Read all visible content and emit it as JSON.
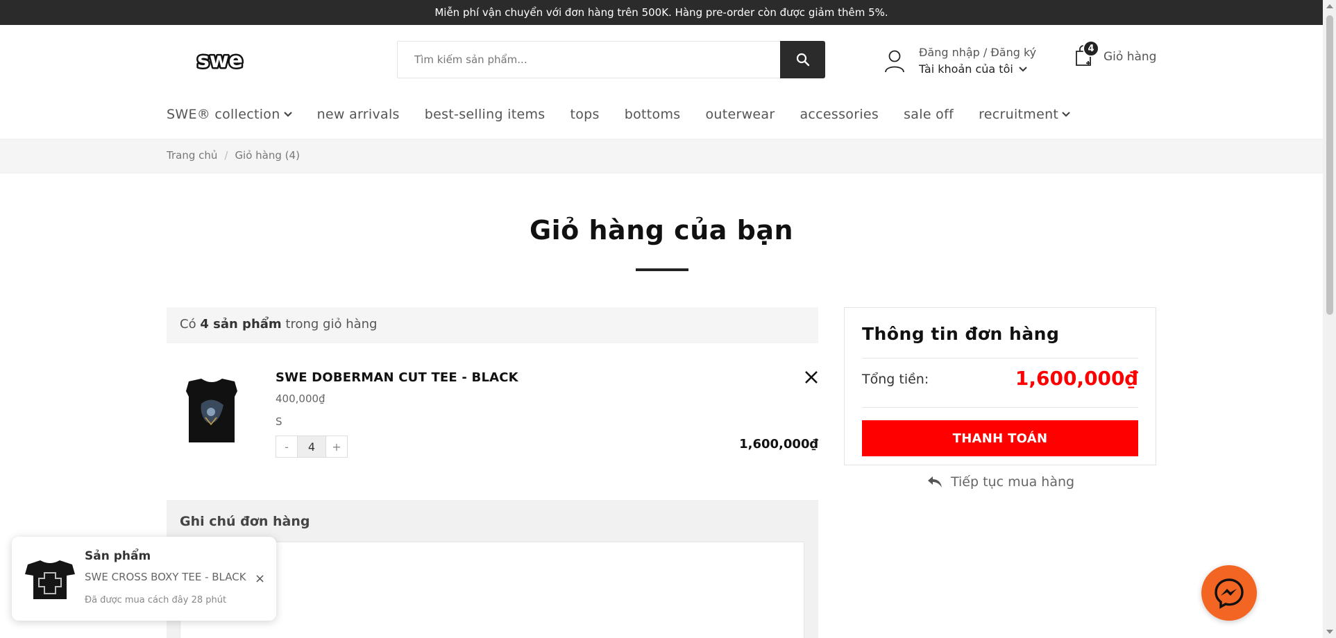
{
  "topbar": {
    "text": "Miễn phí vận chuyển với đơn hàng trên 500K. Hàng pre-order còn được giảm thêm 5%."
  },
  "header": {
    "logo_text": "swe",
    "search_placeholder": "Tìm kiếm sản phẩm...",
    "account_line1": "Đăng nhập / Đăng ký",
    "account_line2": "Tài khoản của tôi",
    "cart_count": "4",
    "cart_label": "Giỏ hàng"
  },
  "nav": {
    "items": [
      {
        "label": "SWE® collection"
      },
      {
        "label": "new arrivals"
      },
      {
        "label": "best-selling items"
      },
      {
        "label": "tops"
      },
      {
        "label": "bottoms"
      },
      {
        "label": "outerwear"
      },
      {
        "label": "accessories"
      },
      {
        "label": "sale off"
      },
      {
        "label": "recruitment"
      }
    ]
  },
  "breadcrumb": {
    "home": "Trang chủ",
    "sep": "/",
    "current": "Giỏ hàng (4)"
  },
  "cart": {
    "title": "Giỏ hàng của bạn",
    "count_prefix": "Có",
    "count_bold": "4 sản phẩm",
    "count_suffix": "trong giỏ hàng",
    "items": [
      {
        "name": "SWE DOBERMAN CUT TEE - BLACK",
        "price": "400,000₫",
        "size": "S",
        "qty": "4",
        "minus": "-",
        "plus": "+",
        "line_total": "1,600,000₫"
      }
    ],
    "note_title": "Ghi chú đơn hàng"
  },
  "order": {
    "title": "Thông tin đơn hàng",
    "total_label": "Tổng tiền:",
    "total_value": "1,600,000₫",
    "checkout": "THANH TOÁN",
    "continue": "Tiếp tục mua hàng"
  },
  "toast": {
    "title": "Sản phẩm",
    "product": "SWE CROSS BOXY TEE - BLACK",
    "time": "Đã được mua cách đây 28 phút",
    "close": "×"
  },
  "colors": {
    "accent": "#ff0000",
    "dark": "#2b2b2b",
    "messenger": "#f26522"
  }
}
